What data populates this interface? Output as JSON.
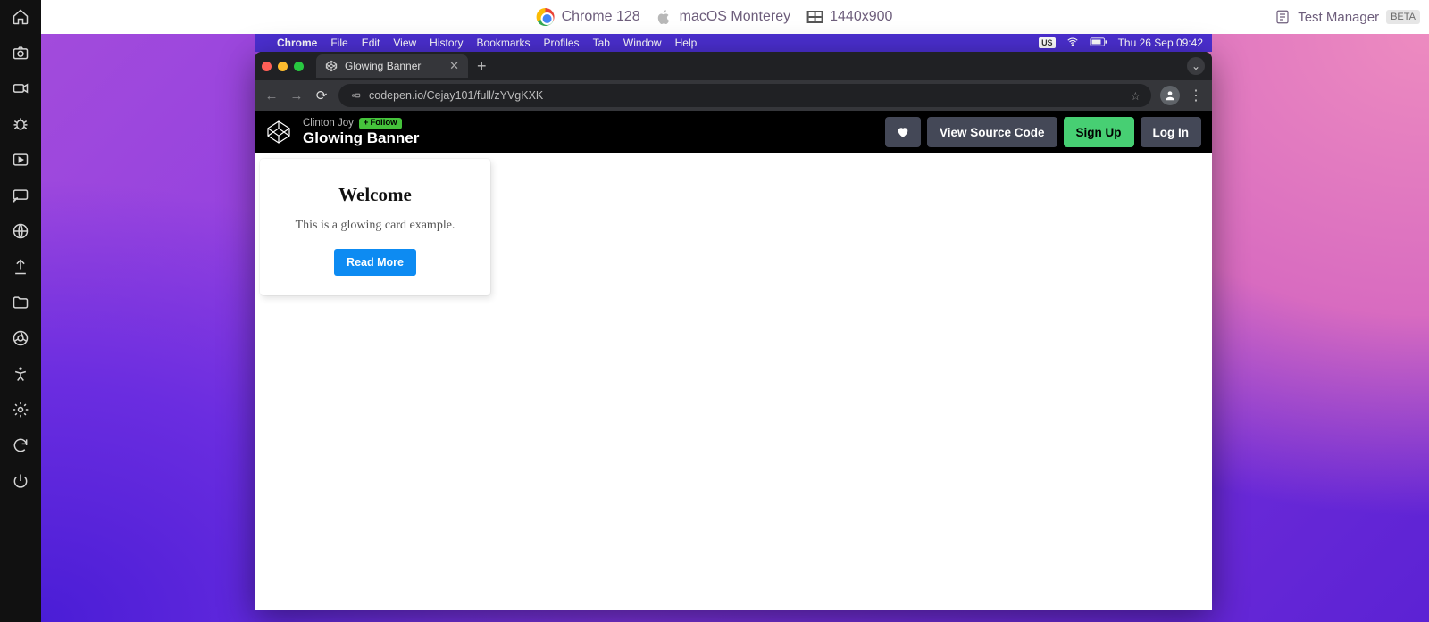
{
  "testRunner": {
    "browser": "Chrome 128",
    "os": "macOS Monterey",
    "resolution": "1440x900",
    "testManagerLabel": "Test Manager",
    "betaBadge": "BETA"
  },
  "macMenuBar": {
    "appName": "Chrome",
    "items": [
      "File",
      "Edit",
      "View",
      "History",
      "Bookmarks",
      "Profiles",
      "Tab",
      "Window",
      "Help"
    ],
    "inputIndicator": "US",
    "clock": "Thu 26 Sep  09:42"
  },
  "chrome": {
    "tabTitle": "Glowing Banner",
    "url": "codepen.io/Cejay101/full/zYVgKXK"
  },
  "codepen": {
    "author": "Clinton Joy",
    "followLabel": "Follow",
    "penTitle": "Glowing Banner",
    "viewSource": "View Source Code",
    "signUp": "Sign Up",
    "logIn": "Log In"
  },
  "card": {
    "heading": "Welcome",
    "body": "This is a glowing card example.",
    "cta": "Read More"
  }
}
